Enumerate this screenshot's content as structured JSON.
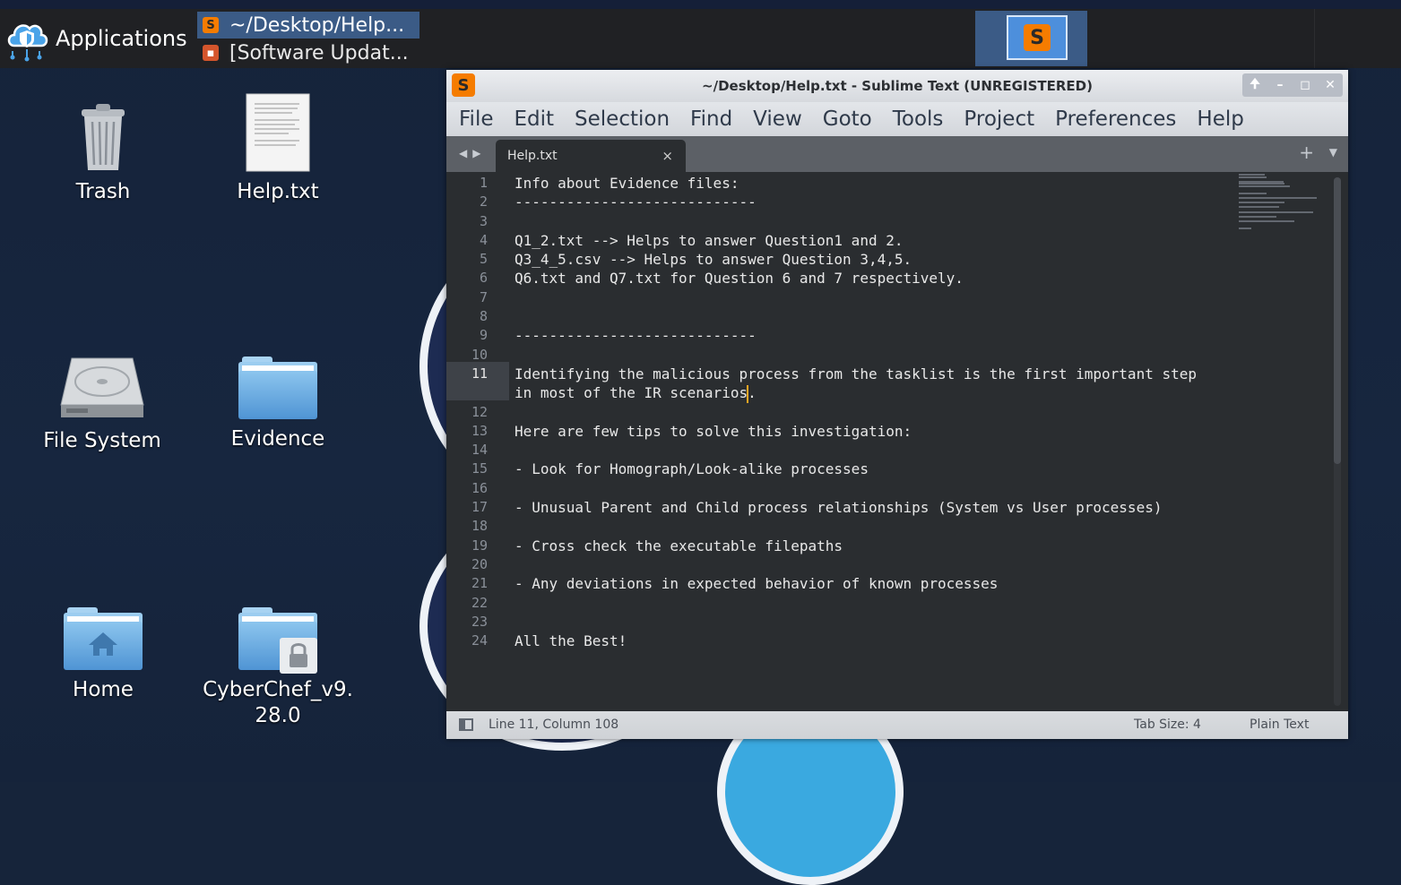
{
  "taskbar": {
    "applications_label": "Applications",
    "tasks": [
      {
        "label": "~/Desktop/Help...",
        "active": true
      },
      {
        "label": "[Software Updat...",
        "active": false
      }
    ]
  },
  "desktop": {
    "icons": {
      "trash": "Trash",
      "help": "Help.txt",
      "filesystem": "File System",
      "evidence": "Evidence",
      "home": "Home",
      "cyberchef_line1": "CyberChef_v9.",
      "cyberchef_line2": "28.0"
    }
  },
  "window": {
    "title": "~/Desktop/Help.txt - Sublime Text (UNREGISTERED)",
    "controls": {
      "up": "🠉",
      "minimize": "–",
      "maximize": "◻",
      "close": "✕"
    },
    "menu": [
      "File",
      "Edit",
      "Selection",
      "Find",
      "View",
      "Goto",
      "Tools",
      "Project",
      "Preferences",
      "Help"
    ],
    "tab": {
      "label": "Help.txt",
      "close": "×",
      "new": "+",
      "menu": "▼",
      "arrows": "◀▶"
    },
    "editor": {
      "current_line": 11,
      "lines": [
        {
          "n": "1",
          "text": "Info about Evidence files:"
        },
        {
          "n": "2",
          "text": "----------------------------"
        },
        {
          "n": "3",
          "text": ""
        },
        {
          "n": "4",
          "text": "Q1_2.txt --> Helps to answer Question1 and 2."
        },
        {
          "n": "5",
          "text": "Q3_4_5.csv --> Helps to answer Question 3,4,5."
        },
        {
          "n": "6",
          "text": "Q6.txt and Q7.txt for Question 6 and 7 respectively."
        },
        {
          "n": "7",
          "text": ""
        },
        {
          "n": "8",
          "text": ""
        },
        {
          "n": "9",
          "text": "----------------------------"
        },
        {
          "n": "10",
          "text": ""
        },
        {
          "n": "11",
          "text": "Identifying the malicious process from the tasklist is the first important step",
          "wrap_before_caret": "in most of the IR scenarios",
          "wrap_after_caret": "."
        },
        {
          "n": "12",
          "text": ""
        },
        {
          "n": "13",
          "text": "Here are few tips to solve this investigation:"
        },
        {
          "n": "14",
          "text": ""
        },
        {
          "n": "15",
          "text": "- Look for Homograph/Look-alike processes"
        },
        {
          "n": "16",
          "text": ""
        },
        {
          "n": "17",
          "text": "- Unusual Parent and Child process relationships (System vs User processes)"
        },
        {
          "n": "18",
          "text": ""
        },
        {
          "n": "19",
          "text": "- Cross check the executable filepaths"
        },
        {
          "n": "20",
          "text": ""
        },
        {
          "n": "21",
          "text": "- Any deviations in expected behavior of known processes"
        },
        {
          "n": "22",
          "text": ""
        },
        {
          "n": "23",
          "text": ""
        },
        {
          "n": "24",
          "text": "All the Best!"
        }
      ]
    },
    "status": {
      "position": "Line 11, Column 108",
      "tab_size": "Tab Size: 4",
      "syntax": "Plain Text"
    }
  },
  "icons": {
    "app_logo": "sublime-text-logo",
    "menu_logo": "cloud-shield-icon",
    "trash": "trash-icon",
    "document": "text-document-icon",
    "drive": "hard-drive-icon",
    "folder": "folder-icon",
    "home_folder": "home-folder-icon",
    "locked_folder": "locked-folder-icon"
  },
  "colors": {
    "desktop_bg": "#16243a",
    "editor_bg": "#2a2d30",
    "caret": "#f5a623",
    "accent": "#3b5b86",
    "sublime_orange": "#f57c00"
  }
}
